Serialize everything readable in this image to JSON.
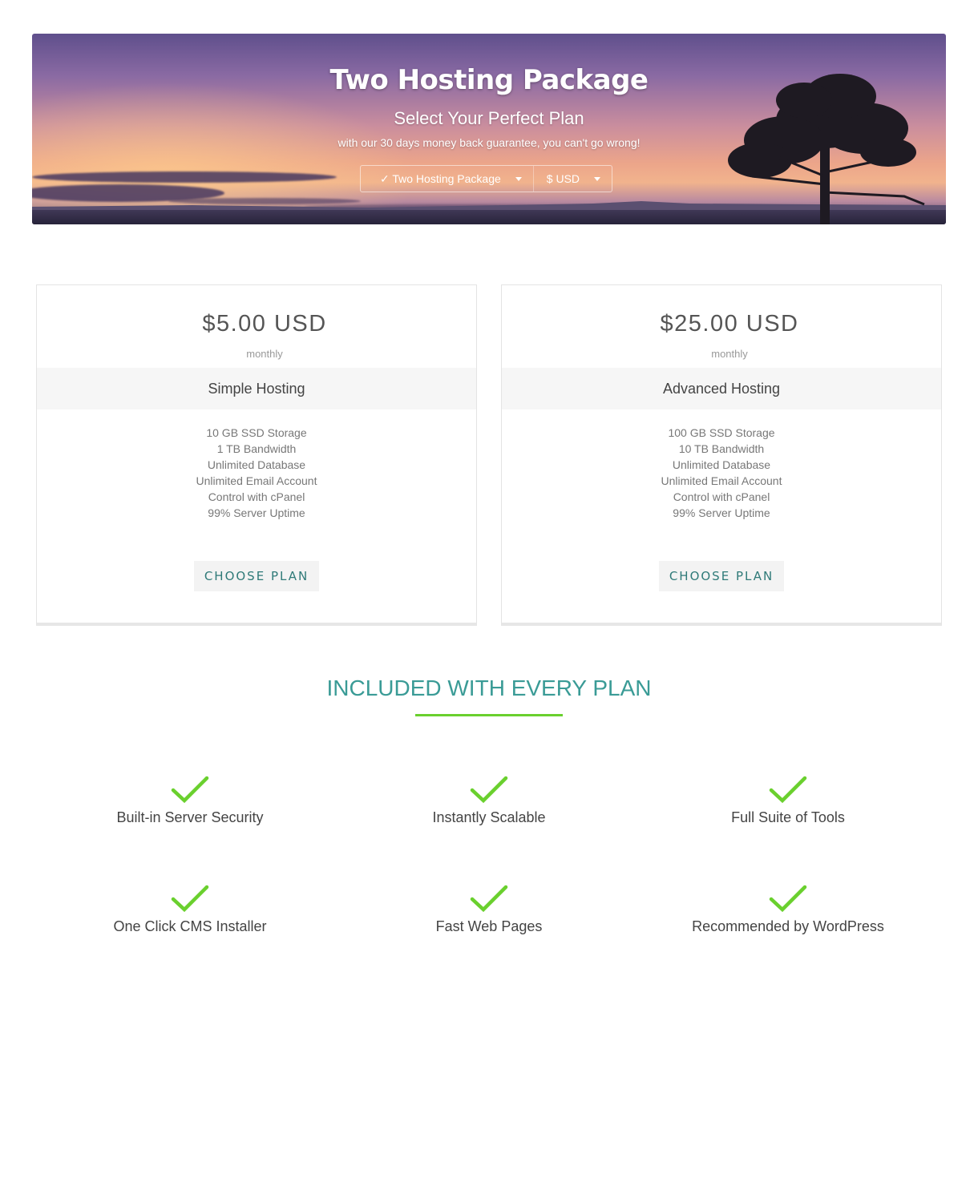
{
  "hero": {
    "title": "Two Hosting Package",
    "subtitle": "Select Your Perfect Plan",
    "tagline": "with our 30 days money back guarantee, you can't go wrong!",
    "package_selector": "✓ Two Hosting Package",
    "currency_selector": "$ USD"
  },
  "plans": [
    {
      "price": "$5.00 USD",
      "period": "monthly",
      "name": "Simple Hosting",
      "features": [
        "10 GB SSD Storage",
        "1 TB Bandwidth",
        "Unlimited Database",
        "Unlimited Email Account",
        "Control with cPanel",
        "99% Server Uptime"
      ],
      "button": "CHOOSE PLAN"
    },
    {
      "price": "$25.00 USD",
      "period": "monthly",
      "name": "Advanced Hosting",
      "features": [
        "100 GB SSD Storage",
        "10 TB Bandwidth",
        "Unlimited Database",
        "Unlimited Email Account",
        "Control with cPanel",
        "99% Server Uptime"
      ],
      "button": "CHOOSE PLAN"
    }
  ],
  "included": {
    "title": "INCLUDED WITH EVERY PLAN",
    "items": [
      "Built-in Server Security",
      "Instantly Scalable",
      "Full Suite of Tools",
      "One Click CMS Installer",
      "Fast Web Pages",
      "Recommended by WordPress"
    ]
  },
  "colors": {
    "accent_teal": "#3a9b96",
    "button_text": "#2f7a78",
    "check_green": "#6ad02e"
  },
  "icons": {
    "check": "check-icon",
    "caret": "caret-down-icon",
    "tree": "tree-silhouette"
  }
}
